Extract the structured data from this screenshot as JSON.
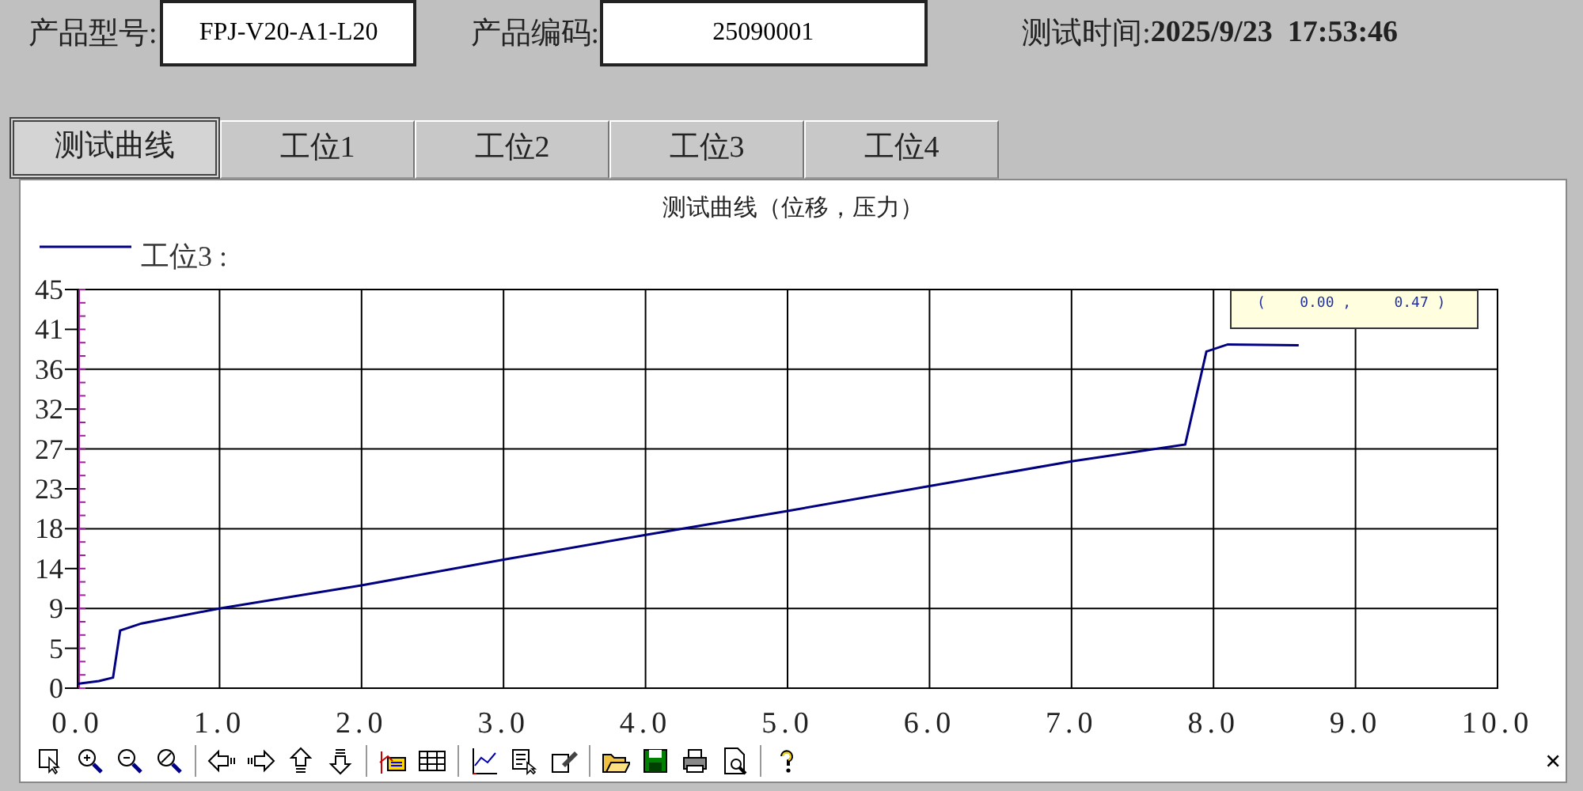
{
  "header": {
    "model_label": "产品型号:",
    "model_value": "FPJ-V20-A1-L20",
    "code_label": "产品编码:",
    "code_value": "25090001",
    "time_label": "测试时间:",
    "time_value": "2025/9/23  17:53:46"
  },
  "tabs": [
    {
      "label": "测试曲线",
      "selected": true
    },
    {
      "label": "工位1",
      "selected": false
    },
    {
      "label": "工位2",
      "selected": false
    },
    {
      "label": "工位3",
      "selected": false
    },
    {
      "label": "工位4",
      "selected": false
    }
  ],
  "chart": {
    "tooltip": "(    0.00 ,     0.47 )",
    "chart_data": {
      "type": "line",
      "title": "测试曲线（位移，压力）",
      "x": [
        0,
        0.15,
        0.25,
        0.3,
        0.45,
        1,
        2,
        3,
        4,
        5,
        6,
        7,
        7.8,
        7.95,
        8.1,
        8.6
      ],
      "series": [
        {
          "name": "工位3 :",
          "color": "#000080",
          "values": [
            0.5,
            0.8,
            1.2,
            6.5,
            7.3,
            9,
            11.6,
            14.5,
            17.3,
            20,
            22.8,
            25.6,
            27.5,
            38,
            38.8,
            38.7
          ]
        }
      ],
      "xlim": [
        0,
        10
      ],
      "ylim": [
        0,
        45
      ],
      "grid": true,
      "xticks": [
        {
          "value": 0,
          "label": "0.0"
        },
        {
          "value": 1,
          "label": "1.0"
        },
        {
          "value": 2,
          "label": "2.0"
        },
        {
          "value": 3,
          "label": "3.0"
        },
        {
          "value": 4,
          "label": "4.0"
        },
        {
          "value": 5,
          "label": "5.0"
        },
        {
          "value": 6,
          "label": "6.0"
        },
        {
          "value": 7,
          "label": "7.0"
        },
        {
          "value": 8,
          "label": "8.0"
        },
        {
          "value": 9,
          "label": "9.0"
        },
        {
          "value": 10,
          "label": "10.0"
        }
      ],
      "yticks": [
        {
          "value": 0,
          "label": "0"
        },
        {
          "value": 4.5,
          "label": "5"
        },
        {
          "value": 9,
          "label": "9"
        },
        {
          "value": 13.5,
          "label": "14"
        },
        {
          "value": 18,
          "label": "18"
        },
        {
          "value": 22.5,
          "label": "23"
        },
        {
          "value": 27,
          "label": "27"
        },
        {
          "value": 31.5,
          "label": "32"
        },
        {
          "value": 36,
          "label": "36"
        },
        {
          "value": 40.5,
          "label": "41"
        },
        {
          "value": 45,
          "label": "45"
        }
      ]
    }
  },
  "close": "×"
}
